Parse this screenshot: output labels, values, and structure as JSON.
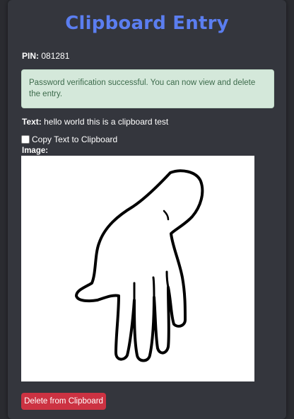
{
  "header": {
    "title": "Clipboard Entry"
  },
  "entry": {
    "pin_label": "PIN:",
    "pin_value": "081281",
    "text_label": "Text:",
    "text_value": "hello world this is a clipboard test",
    "image_label": "Image:"
  },
  "alert": {
    "message": "Password verification successful. You can now view and delete the entry."
  },
  "copy_option": {
    "label": "Copy Text to Clipboard",
    "checked": false
  },
  "actions": {
    "delete_label": "Delete from Clipboard"
  },
  "colors": {
    "title": "#5b7ef0",
    "alert_bg": "#d4e8da",
    "alert_text": "#3d6b4c",
    "delete_button": "#cc3242",
    "card_bg": "#34363d"
  }
}
